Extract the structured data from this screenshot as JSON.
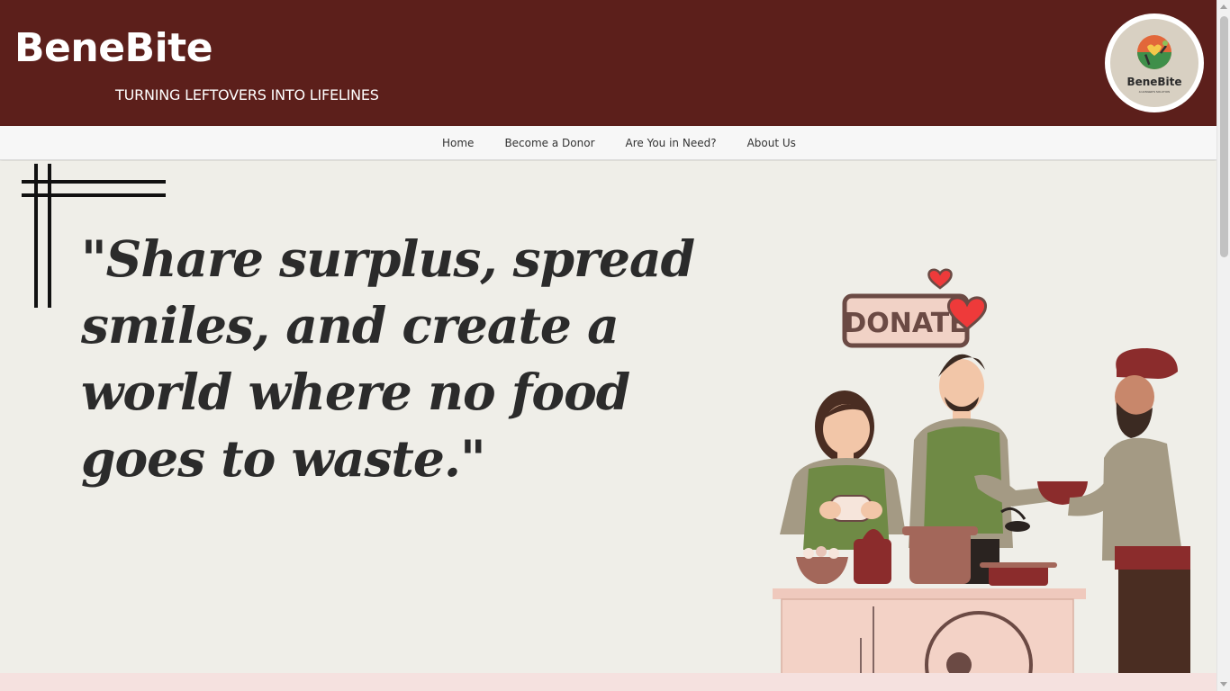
{
  "header": {
    "title": "BeneBite",
    "tagline": "TURNING LEFTOVERS INTO LIFELINES",
    "logo_text": "BeneBite",
    "logo_subtext": "A HUNGER'S SOLUTION"
  },
  "nav": {
    "items": [
      {
        "label": "Home"
      },
      {
        "label": "Become a Donor"
      },
      {
        "label": "Are You in Need?"
      },
      {
        "label": "About Us"
      }
    ]
  },
  "hero": {
    "quote": "\"Share surplus, spread smiles, and create a world where no food goes to waste.\"",
    "sign_text": "DONATE"
  },
  "colors": {
    "header_bg": "#5c1f1b",
    "hero_bg": "#efeee8",
    "footer_strip": "#f5e1df",
    "vest_green": "#6f8a45",
    "accent_maroon": "#8b2c2c"
  }
}
